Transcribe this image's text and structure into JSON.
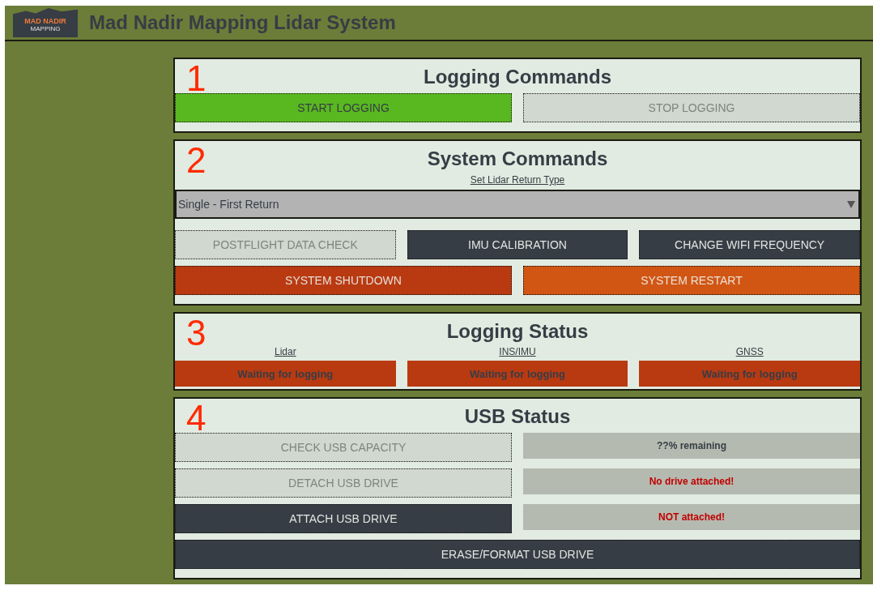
{
  "header": {
    "logo": {
      "wordmark": "MAD NADIR",
      "tagline": "MAPPING"
    },
    "title": "Mad Nadir Mapping Lidar System"
  },
  "logging_commands": {
    "number": "1",
    "title": "Logging Commands",
    "buttons": [
      {
        "label": "START LOGGING",
        "kind": "start",
        "disabled": false
      },
      {
        "label": "STOP LOGGING",
        "disabled": true
      }
    ]
  },
  "system_commands": {
    "number": "2",
    "title": "System Commands",
    "select_label": "Set Lidar Return Type",
    "select": {
      "value": "Single - First Return"
    },
    "buttons_row_1": [
      {
        "label": "POSTFLIGHT DATA CHECK",
        "disabled": true
      },
      {
        "label": "IMU CALIBRATION",
        "kind": "dark",
        "disabled": false
      },
      {
        "label": "CHANGE WIFI FREQUENCY",
        "kind": "dark",
        "disabled": false
      }
    ],
    "buttons_row_2": [
      {
        "label": "SYSTEM SHUTDOWN",
        "kind": "danger",
        "disabled": false
      },
      {
        "label": "SYSTEM RESTART",
        "kind": "warning",
        "disabled": false
      }
    ]
  },
  "logging_status": {
    "number": "3",
    "title": "Logging Status",
    "sensors": [
      {
        "name": "Lidar",
        "status": "Waiting for logging"
      },
      {
        "name": "INS/IMU",
        "status": "Waiting for logging"
      },
      {
        "name": "GNSS",
        "status": "Waiting for logging"
      }
    ]
  },
  "usb_status": {
    "number": "4",
    "title": "USB Status",
    "rows": [
      {
        "button": {
          "label": "CHECK USB CAPACITY",
          "disabled": true
        },
        "status": {
          "text": "??% remaining",
          "alert": false
        }
      },
      {
        "button": {
          "label": "DETACH USB DRIVE",
          "disabled": true
        },
        "status": {
          "text": "No drive attached!",
          "alert": true
        }
      },
      {
        "button": {
          "label": "ATTACH USB DRIVE",
          "kind": "dark",
          "disabled": false
        },
        "status": {
          "text": "NOT attached!",
          "alert": true
        }
      }
    ],
    "erase_button": {
      "label": "ERASE/FORMAT USB DRIVE",
      "kind": "dark",
      "disabled": false
    }
  }
}
